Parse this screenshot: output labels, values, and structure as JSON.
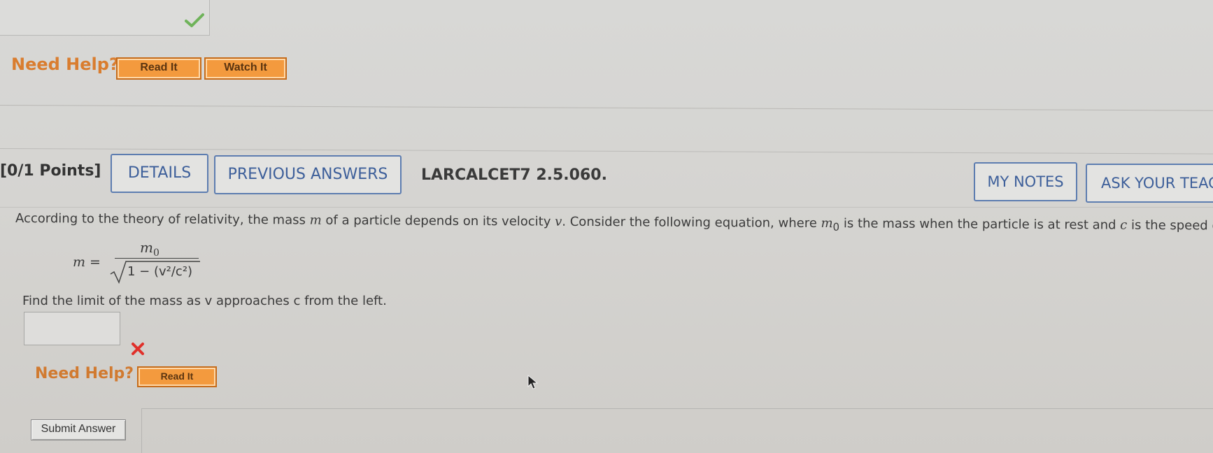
{
  "top": {
    "need_help_label": "Need Help?",
    "read_it_label": "Read It",
    "watch_it_label": "Watch It",
    "check_icon": "check-icon"
  },
  "question": {
    "points": "[0/1 Points]",
    "details_label": "DETAILS",
    "previous_answers_label": "PREVIOUS ANSWERS",
    "problem_id": "LARCALCET7 2.5.060.",
    "my_notes_label": "MY NOTES",
    "ask_teacher_label": "ASK YOUR TEACH",
    "text_parts": {
      "p1": "According to the theory of relativity, the mass ",
      "m": "m",
      "p2": " of a particle depends on its velocity ",
      "v": "v",
      "p3": ". Consider the following equation, where ",
      "m0": "m",
      "m0_sub": "0",
      "p4": " is the mass when the particle is at rest and ",
      "c": "c",
      "p5": " is the speed of ligh"
    },
    "equation": {
      "lhs": "m =",
      "numerator": "m",
      "numerator_sub": "0",
      "denominator": "1 − (v²/c²)"
    },
    "find_text": "Find the limit of the mass as v approaches c from the left.",
    "answer_value": "",
    "answer_status_icon": "x-icon",
    "need_help_label": "Need Help?",
    "read_it_label": "Read It"
  },
  "footer": {
    "submit_label": "Submit Answer"
  },
  "colors": {
    "orange": "#f39a3e",
    "need_help": "#d97d2f",
    "blue_outline": "#5d7db0",
    "check_green": "#6fb35a",
    "x_red": "#e0302a"
  }
}
